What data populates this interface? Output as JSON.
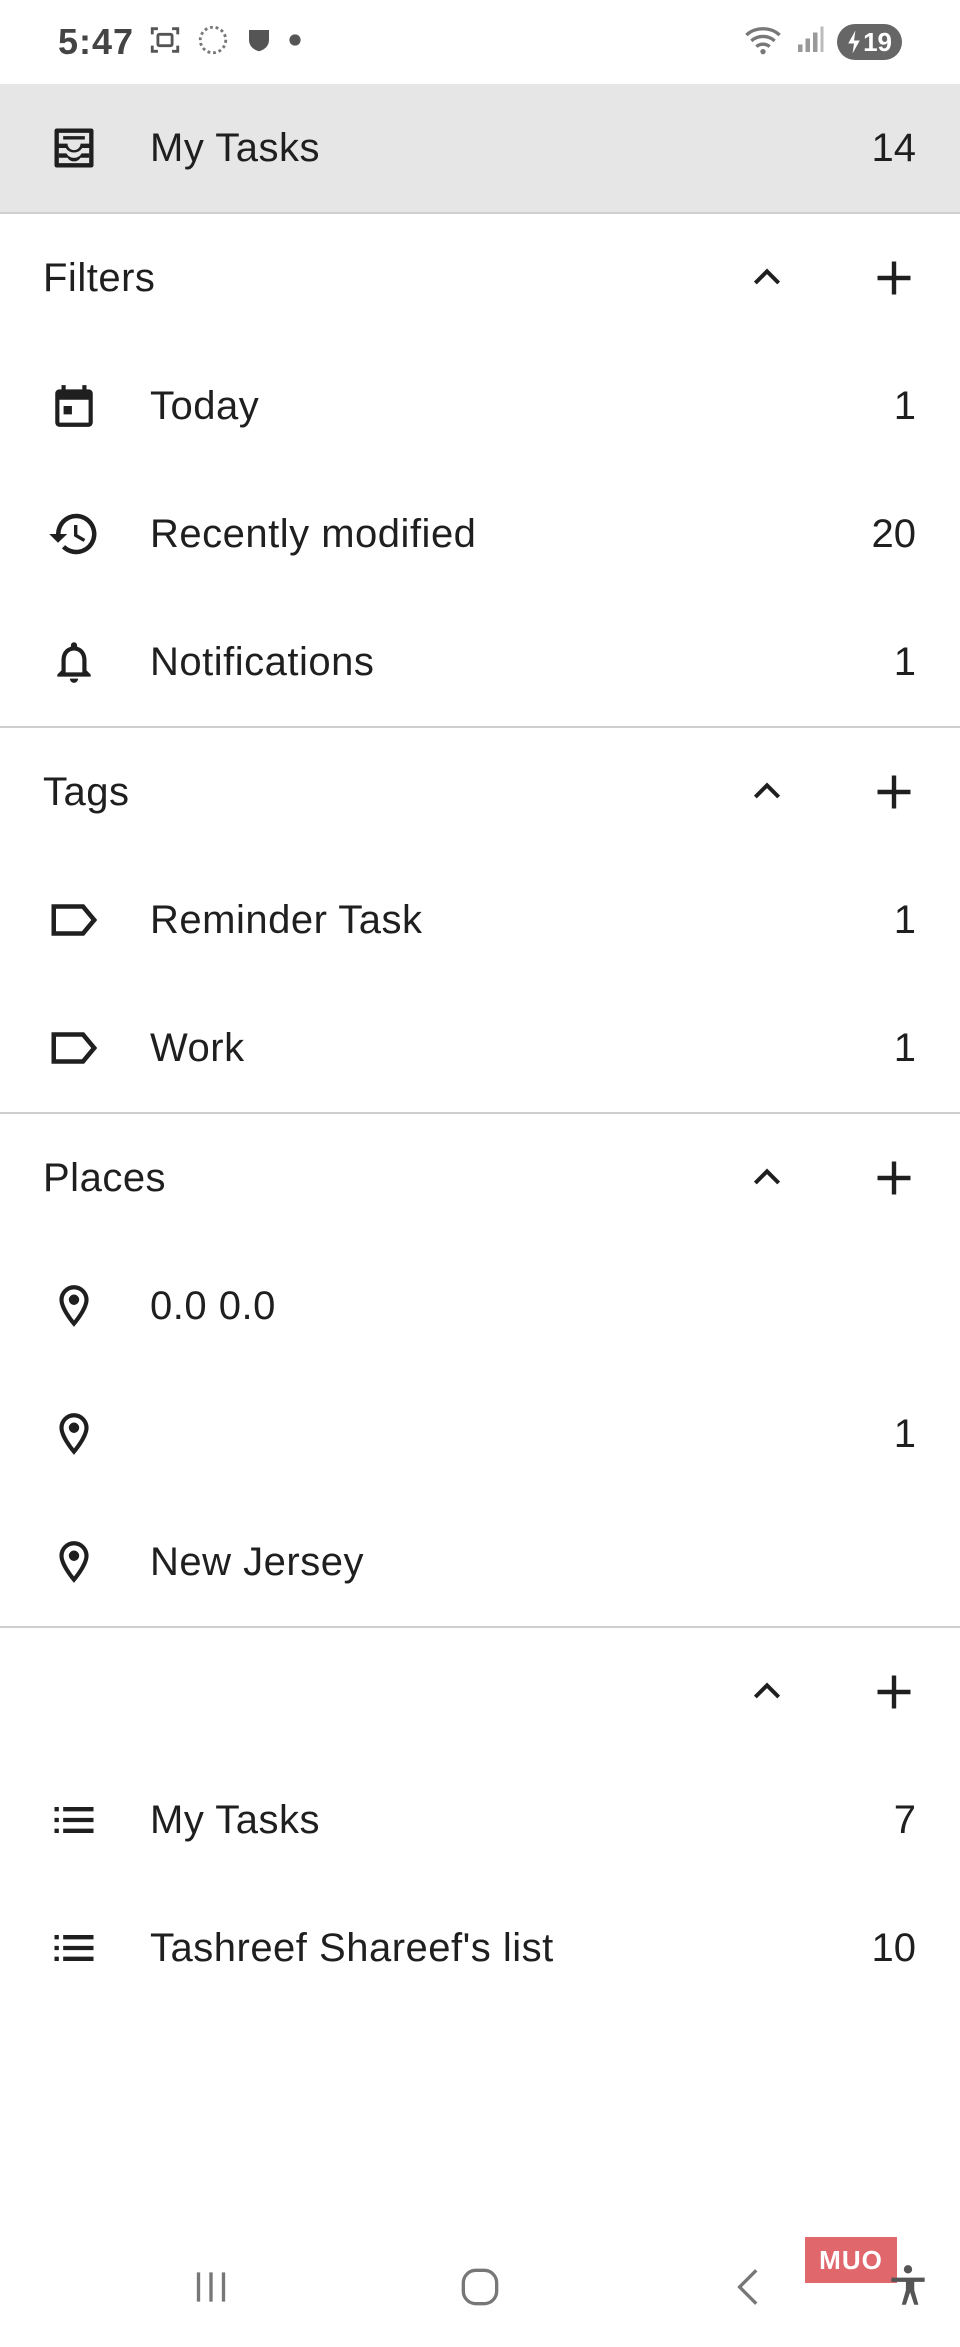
{
  "status_bar": {
    "time": "5:47",
    "battery": "19",
    "icons": [
      "screenshot-icon",
      "loading-icon",
      "shield-icon",
      "dot-icon",
      "wifi-icon",
      "signal-icon",
      "battery-icon"
    ]
  },
  "drawer": {
    "top_item": {
      "label": "My Tasks",
      "count": "14",
      "icon": "inbox-icon"
    },
    "sections": {
      "filters": {
        "title": "Filters",
        "items": [
          {
            "label": "Today",
            "count": "1",
            "icon": "calendar-icon"
          },
          {
            "label": "Recently modified",
            "count": "20",
            "icon": "history-icon"
          },
          {
            "label": "Notifications",
            "count": "1",
            "icon": "bell-icon"
          }
        ]
      },
      "tags": {
        "title": "Tags",
        "items": [
          {
            "label": "Reminder Task",
            "count": "1",
            "icon": "tag-icon"
          },
          {
            "label": "Work",
            "count": "1",
            "icon": "tag-icon"
          }
        ]
      },
      "places": {
        "title": "Places",
        "items": [
          {
            "label": "0.0 0.0",
            "count": "",
            "icon": "place-icon"
          },
          {
            "label": "",
            "count": "1",
            "icon": "place-icon"
          },
          {
            "label": "New Jersey",
            "count": "",
            "icon": "place-icon"
          }
        ]
      },
      "lists": {
        "title": "",
        "items": [
          {
            "label": "My Tasks",
            "count": "7",
            "icon": "list-icon"
          },
          {
            "label": "Tashreef Shareef's list",
            "count": "10",
            "icon": "list-icon"
          }
        ]
      }
    }
  },
  "watermark": {
    "text": "MUO"
  },
  "colors": {
    "selected_bg": "#e6e6e6",
    "divider": "#cfcfcf",
    "text": "#1f1f1f",
    "watermark": "#e0686c"
  }
}
